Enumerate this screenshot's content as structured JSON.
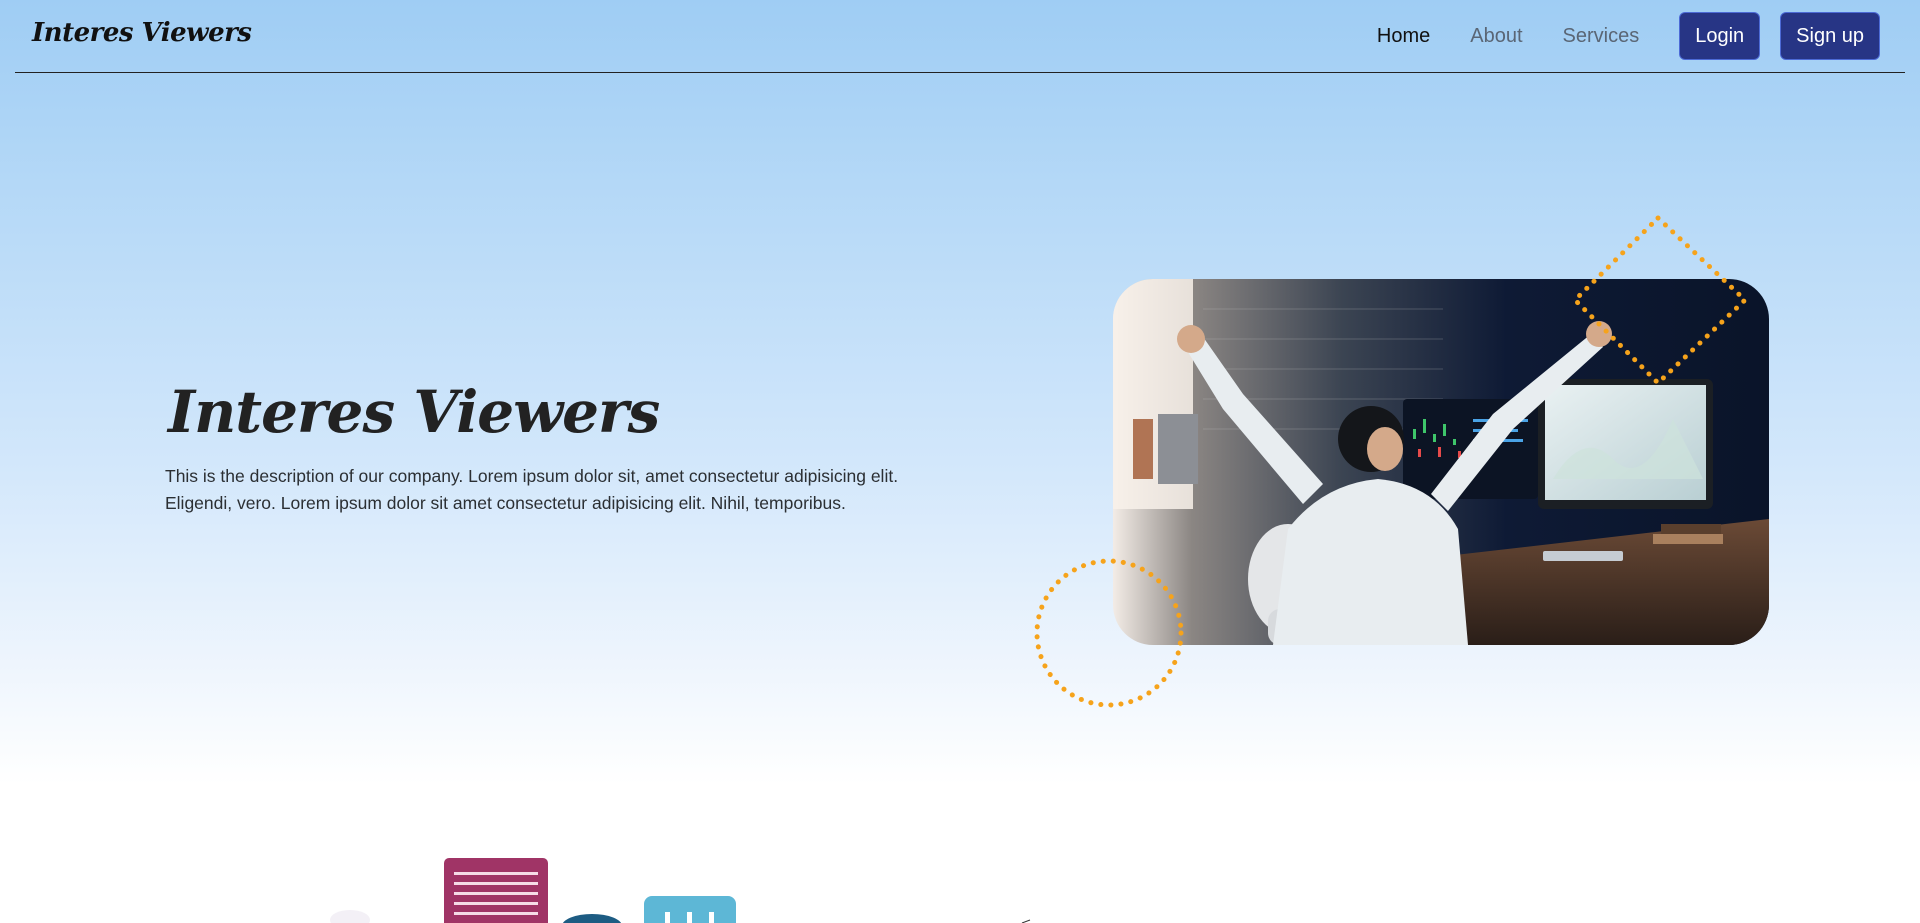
{
  "navbar": {
    "brand": "Interes Viewers",
    "links": [
      {
        "label": "Home",
        "active": true
      },
      {
        "label": "About",
        "active": false
      },
      {
        "label": "Services",
        "active": false
      }
    ],
    "login_label": "Login",
    "signup_label": "Sign up"
  },
  "hero": {
    "title": "Interes Viewers",
    "description_line1": "This is the description of our company. Lorem ipsum dolor sit, amet consectetur adipisicing elit.",
    "description_line2": "Eligendi, vero. Lorem ipsum dolor sit amet consectetur adipisicing elit. Nihil, temporibus.",
    "image_icon": "office-celebration-photo"
  },
  "colors": {
    "accent": "#273585",
    "decor": "#f6a31b",
    "bg_top": "#9fcdf4"
  }
}
